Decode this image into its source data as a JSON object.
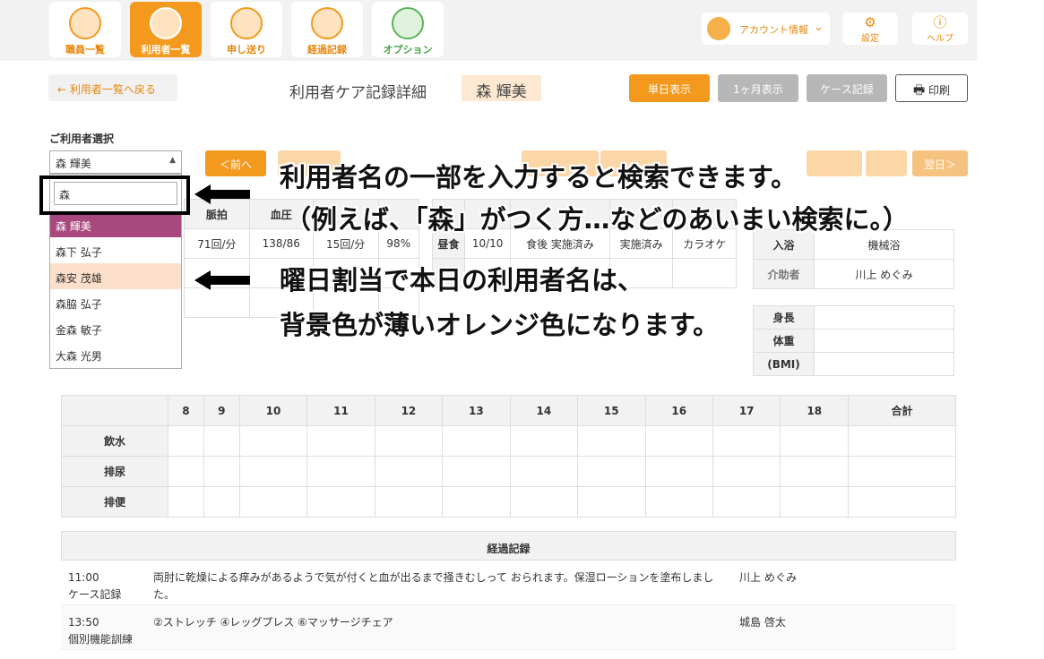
{
  "nav": {
    "items": [
      {
        "label": "職員一覧",
        "icon": "staff-face-icon",
        "active": false
      },
      {
        "label": "利用者一覧",
        "icon": "user-face-icon",
        "active": true
      },
      {
        "label": "申し送り",
        "icon": "handover-icon",
        "active": false
      },
      {
        "label": "経過記録",
        "icon": "progress-record-icon",
        "active": false
      },
      {
        "label": "オプション",
        "icon": "book-icon",
        "active": false
      }
    ],
    "account_label": "アカウント情報",
    "settings_label": "設定",
    "help_label": "ヘルプ"
  },
  "header": {
    "back_label": "← 利用者一覧へ戻る",
    "title": "利用者ケア記録詳細",
    "user_name": "森 輝美",
    "view_day_label": "単日表示",
    "view_month_label": "1ヶ月表示",
    "case_record_label": "ケース記録",
    "print_label": "印刷"
  },
  "selector": {
    "label": "ご利用者選択",
    "selected": "森 輝美",
    "prev_label": "＜前へ",
    "next_label": "翌日＞",
    "search_value": "森",
    "options": [
      {
        "name": "森 輝美",
        "state": "selected"
      },
      {
        "name": "森下 弘子",
        "state": "normal"
      },
      {
        "name": "森安 茂雄",
        "state": "today"
      },
      {
        "name": "森脇 弘子",
        "state": "normal"
      },
      {
        "name": "金森 敏子",
        "state": "normal"
      },
      {
        "name": "大森 光男",
        "state": "normal"
      }
    ]
  },
  "captions": {
    "line1": "利用者名の一部を入力すると検索できます。",
    "line2": "（例えば、「森」がつく方…などのあいまい検索に。）",
    "line3": "曜日割当で本日の利用者名は、",
    "line4": "背景色が薄いオレンジ色になります。"
  },
  "vitals": {
    "headers": [
      "脈拍",
      "血圧",
      "",
      ""
    ],
    "values": [
      "71回/分",
      "138/86",
      "15回/分",
      "98%"
    ]
  },
  "meal": {
    "label": "昼食",
    "values": [
      "10/10",
      "食後 実施済み",
      "実施済み",
      "カラオケ"
    ]
  },
  "bath": {
    "label": "入浴",
    "value": "機械浴",
    "helper_label": "介助者",
    "helper_value": "川上 めぐみ"
  },
  "body": {
    "rows": [
      "身長",
      "体重",
      "(BMI)"
    ]
  },
  "intake": {
    "hours": [
      "8",
      "9",
      "10",
      "11",
      "12",
      "13",
      "14",
      "15",
      "16",
      "17",
      "18"
    ],
    "total_label": "合計",
    "rows": [
      "飲水",
      "排尿",
      "排便"
    ]
  },
  "progress": {
    "title": "経過記録",
    "entries": [
      {
        "time": "11:00",
        "type": "ケース記録",
        "text": "両肘に乾燥による痒みがあるようで気が付くと血が出るまで掻きむしって おられます。保湿ローションを塗布しました。",
        "staff": "川上 めぐみ"
      },
      {
        "time": "13:50",
        "type": "個別機能訓練",
        "text": "②ストレッチ ④レッグプレス ⑥マッサージチェア",
        "staff": "城島 啓太"
      }
    ]
  },
  "colors": {
    "accent": "#f39a1e",
    "selected_item": "#a8487e",
    "today_item": "#fde0cc",
    "header_bg": "#f2f2f2"
  }
}
